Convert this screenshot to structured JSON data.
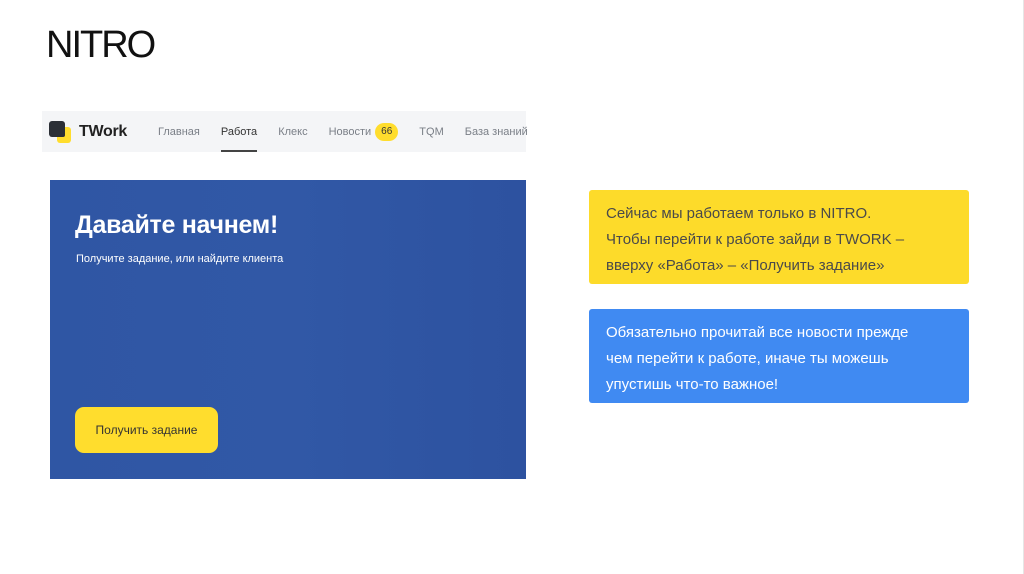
{
  "slide": {
    "title": "NITRO"
  },
  "navbar": {
    "logo_text": "TWork",
    "items": [
      {
        "label": "Главная"
      },
      {
        "label": "Работа",
        "active": true
      },
      {
        "label": "Клекс"
      },
      {
        "label": "Новости",
        "badge": "66"
      },
      {
        "label": "TQM"
      },
      {
        "label": "База знаний"
      }
    ]
  },
  "hero": {
    "heading": "Давайте начнем!",
    "subtitle": "Получите задание, или найдите клиента",
    "button_label": "Получить задание"
  },
  "callouts": {
    "yellow": {
      "lines": [
        "Сейчас мы работаем только в NITRO.",
        "Чтобы перейти к работе зайди в TWORK –",
        "вверху «Работа» – «Получить задание»"
      ]
    },
    "blue": {
      "lines": [
        "Обязательно прочитай все новости прежде",
        "чем перейти к работе, иначе ты можешь",
        "упустишь что-то важное!"
      ]
    }
  },
  "colors": {
    "accent_yellow": "#ffdd2d",
    "hero_blue": "#3158a6",
    "callout_yellow": "#fddb2a",
    "callout_blue": "#408af2"
  }
}
